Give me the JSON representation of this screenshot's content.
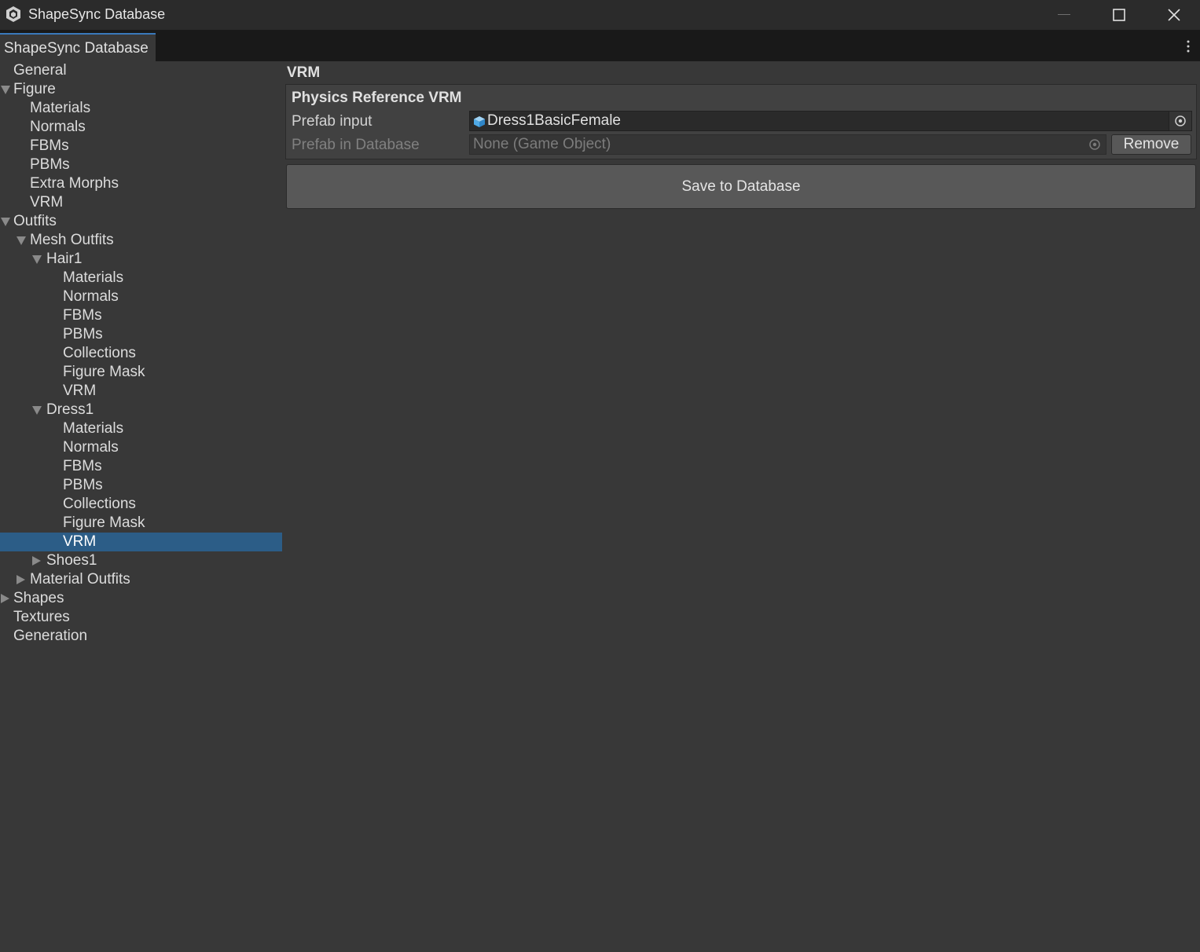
{
  "window": {
    "title": "ShapeSync Database",
    "icon": "unity-logo-icon",
    "controls": [
      "minimize-icon",
      "maximize-icon",
      "close-icon"
    ]
  },
  "tab": {
    "label": "ShapeSync Database"
  },
  "tree": {
    "items": [
      {
        "label": "General"
      },
      {
        "label": "Figure",
        "expanded": true
      },
      {
        "label": "Materials"
      },
      {
        "label": "Normals"
      },
      {
        "label": "FBMs"
      },
      {
        "label": "PBMs"
      },
      {
        "label": "Extra Morphs"
      },
      {
        "label": "VRM"
      },
      {
        "label": "Outfits",
        "expanded": true
      },
      {
        "label": "Mesh Outfits",
        "expanded": true
      },
      {
        "label": "Hair1",
        "expanded": true
      },
      {
        "label": "Materials"
      },
      {
        "label": "Normals"
      },
      {
        "label": "FBMs"
      },
      {
        "label": "PBMs"
      },
      {
        "label": "Collections"
      },
      {
        "label": "Figure Mask"
      },
      {
        "label": "VRM"
      },
      {
        "label": "Dress1",
        "expanded": true
      },
      {
        "label": "Materials"
      },
      {
        "label": "Normals"
      },
      {
        "label": "FBMs"
      },
      {
        "label": "PBMs"
      },
      {
        "label": "Collections"
      },
      {
        "label": "Figure Mask"
      },
      {
        "label": "VRM",
        "selected": true
      },
      {
        "label": "Shoes1",
        "expanded": false
      },
      {
        "label": "Material Outfits",
        "expanded": false
      },
      {
        "label": "Shapes",
        "expanded": false
      },
      {
        "label": "Textures"
      },
      {
        "label": "Generation"
      }
    ]
  },
  "main": {
    "heading": "VRM",
    "section": {
      "title": "Physics Reference VRM",
      "prefab_input_label": "Prefab input",
      "prefab_input_value": "Dress1BasicFemale",
      "prefab_db_label": "Prefab in Database",
      "prefab_db_value": "None (Game Object)",
      "remove_label": "Remove"
    },
    "save_label": "Save to Database"
  },
  "colors": {
    "selection": "#2c5d87",
    "tab_accent": "#3a79bb",
    "background": "#383838"
  }
}
